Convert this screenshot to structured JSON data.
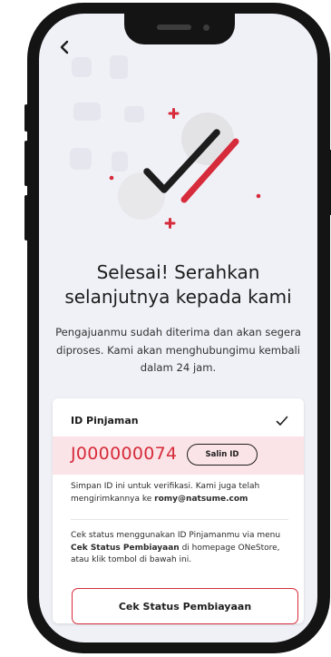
{
  "header": {
    "back_icon": "chevron-left-icon"
  },
  "hero": {
    "icon": "success-checkmark-illustration",
    "accent_color": "#d62b3a"
  },
  "title": {
    "line1": "Selesai! Serahkan",
    "line2": "selanjutnya kepada kami"
  },
  "subtitle": "Pengajuanmu sudah diterima dan akan segera diproses. Kami akan menghubungimu kembali dalam 24 jam.",
  "loan_card": {
    "label": "ID Pinjaman",
    "check_icon": "checkmark-icon",
    "loan_id": "J000000074",
    "copy_button": "Salin ID",
    "note_prefix": "Simpan ID ini untuk verifikasi. Kami juga telah mengirimkannya ke ",
    "email": "romy@natsume.com",
    "info_prefix": "Cek status menggunakan ID Pinjamanmu via menu ",
    "info_bold": "Cek Status Pembiayaan",
    "info_suffix": " di homepage ONeStore, atau klik tombol di bawah ini.",
    "cta_button": "Cek Status Pembiayaan"
  },
  "colors": {
    "accent": "#d62b3a",
    "background": "#f0f1f7",
    "id_highlight": "#fbe4e7"
  }
}
